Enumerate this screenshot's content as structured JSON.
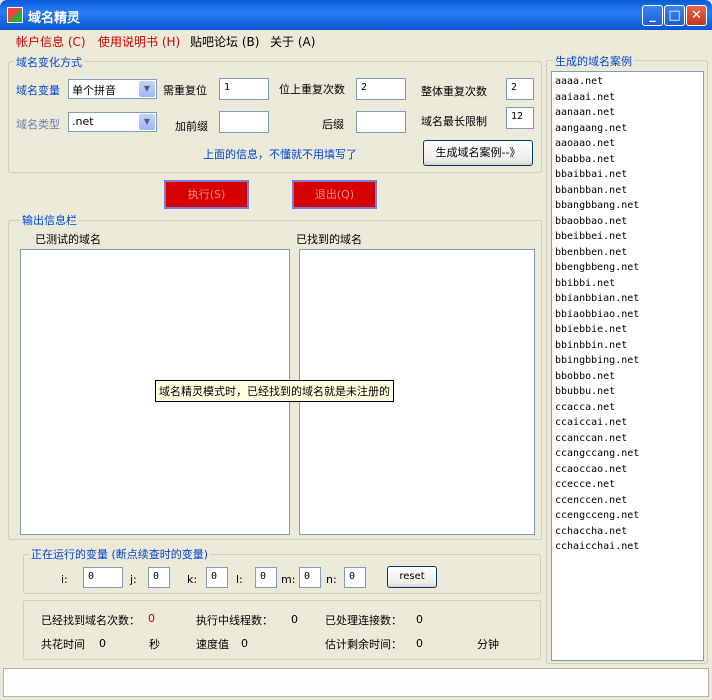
{
  "window": {
    "title": "域名精灵",
    "minimize": "_",
    "maximize": "□",
    "close": "✕"
  },
  "menu": [
    "帐户信息 (C)",
    "使用说明书 (H)",
    "贴吧论坛 (B)",
    "关于 (A)"
  ],
  "variation": {
    "title": "域名变化方式",
    "domain_var_label": "域名变量",
    "domain_var_value": "单个拼音",
    "need_repeat_label": "需重复位",
    "need_repeat_value": "1",
    "pos_repeat_label": "位上重复次数",
    "pos_repeat_value": "2",
    "total_repeat_label": "整体重复次数",
    "total_repeat_value": "2",
    "domain_type_label": "域名类型",
    "domain_type_value": ".net",
    "prefix_label": "加前缀",
    "prefix_value": "",
    "suffix_label": "后缀",
    "suffix_value": "",
    "max_len_label": "域名最长限制",
    "max_len_value": "12",
    "hint": "上面的信息，不懂就不用填写了",
    "gen_button": "生成域名案例--》"
  },
  "actions": {
    "run": "执行(S)",
    "stop": "退出(Q)"
  },
  "output": {
    "title": "输出信息栏",
    "tested_header": "已测试的域名",
    "found_header": "已找到的域名"
  },
  "tooltip": "域名精灵模式时，已经找到的域名就是未注册的",
  "running": {
    "title": "正在运行的变量 (断点续查时的变量)",
    "vars": [
      {
        "label": "i:",
        "value": "0"
      },
      {
        "label": "j:",
        "value": "0"
      },
      {
        "label": "k:",
        "value": "0"
      },
      {
        "label": "l:",
        "value": "0"
      },
      {
        "label": "m:",
        "value": "0"
      },
      {
        "label": "n:",
        "value": "0"
      }
    ],
    "reset": "reset"
  },
  "stats": {
    "found_label": "已经找到域名次数：",
    "found_value": "0",
    "threads_label": "执行中线程数：",
    "threads_value": "0",
    "processed_label": "已处理连接数：",
    "processed_value": "0",
    "time_label": "共花时间",
    "time_value": "0",
    "time_unit": "秒",
    "speed_label": "速度值",
    "speed_value": "0",
    "remaining_label": "估计剩余时间：",
    "remaining_value": "0",
    "remaining_unit": "分钟"
  },
  "examples": {
    "title": "生成的域名案例",
    "list": [
      "aaaa.net",
      "aaiaai.net",
      "aanaan.net",
      "aangaang.net",
      "aaoaao.net",
      "bbabba.net",
      "bbaibbai.net",
      "bbanbban.net",
      "bbangbbang.net",
      "bbaobbao.net",
      "bbeibbei.net",
      "bbenbben.net",
      "bbengbbeng.net",
      "bbibbi.net",
      "bbianbbian.net",
      "bbiaobbiao.net",
      "bbiebbie.net",
      "bbinbbin.net",
      "bbingbbing.net",
      "bbobbo.net",
      "bbubbu.net",
      "ccacca.net",
      "ccaiccai.net",
      "ccanccan.net",
      "ccangccang.net",
      "ccaoccao.net",
      "ccecce.net",
      "ccenccen.net",
      "ccengcceng.net",
      "cchaccha.net",
      "cchaicchai.net"
    ]
  },
  "colors": {
    "accent": "#0046d5",
    "title_bar": "#0a5ad8",
    "button_red": "#d60000",
    "label_red": "#d10000"
  }
}
